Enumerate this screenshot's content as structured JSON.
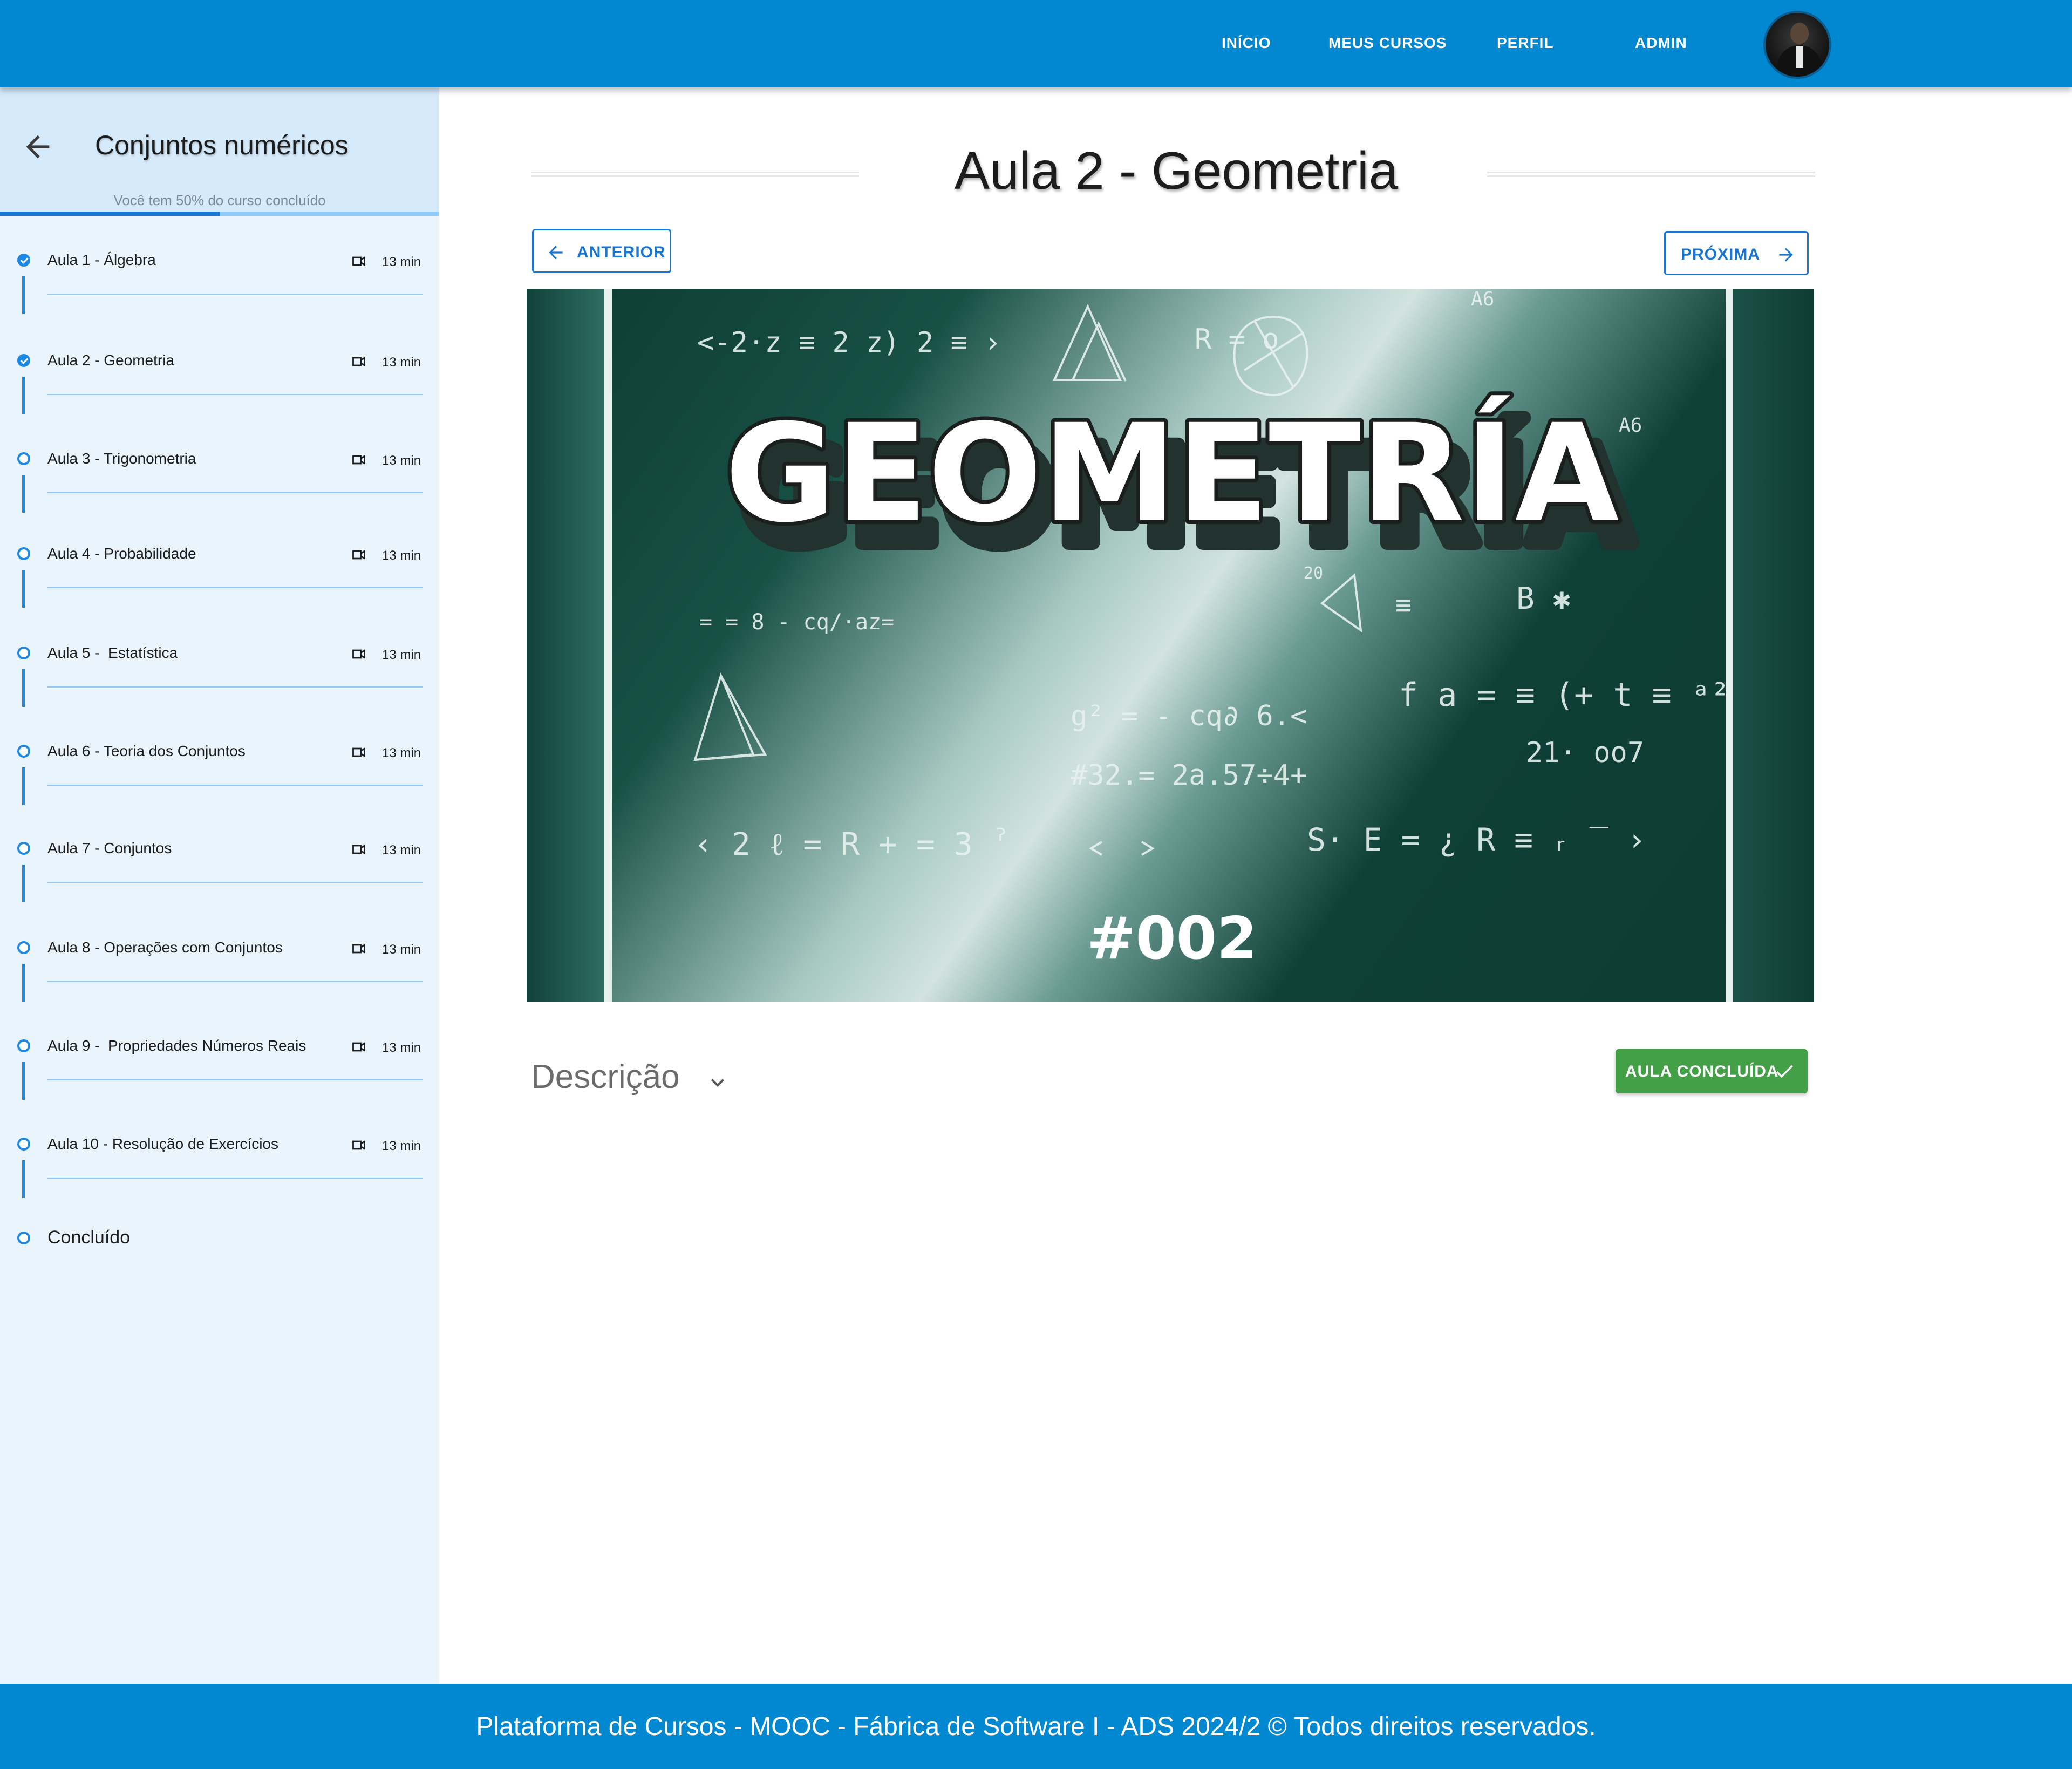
{
  "nav": {
    "items": [
      "INÍCIO",
      "MEUS CURSOS",
      "PERFIL",
      "ADMIN"
    ],
    "avatar_icon": "user-avatar"
  },
  "sidebar": {
    "course_title": "Conjuntos numéricos",
    "progress_text": "Você tem 50% do curso concluído",
    "progress_fraction": 0.5,
    "lessons": [
      {
        "label": "Aula 1 - Álgebra",
        "duration": "13 min",
        "done": true
      },
      {
        "label": "Aula 2 - Geometria",
        "duration": "13 min",
        "done": true
      },
      {
        "label": "Aula 3 - Trigonometria",
        "duration": "13 min",
        "done": false
      },
      {
        "label": "Aula 4 - Probabilidade",
        "duration": "13 min",
        "done": false
      },
      {
        "label": "Aula 5 -  Estatística",
        "duration": "13 min",
        "done": false
      },
      {
        "label": "Aula 6 - Teoria dos Conjuntos",
        "duration": "13 min",
        "done": false
      },
      {
        "label": "Aula 7 - Conjuntos",
        "duration": "13 min",
        "done": false
      },
      {
        "label": "Aula 8 - Operações com Conjuntos",
        "duration": "13 min",
        "done": false
      },
      {
        "label": "Aula 9 -  Propriedades Números Reais",
        "duration": "13 min",
        "done": false
      },
      {
        "label": "Aula 10 - Resolução de Exercícios",
        "duration": "13 min",
        "done": false
      }
    ],
    "concluded_label": "Concluído"
  },
  "main": {
    "title": "Aula 2 - Geometria",
    "prev_label": "ANTERIOR",
    "next_label": "PRÓXIMA",
    "video": {
      "headline": "GEOMETRÍA",
      "episode": "#002"
    },
    "description_label": "Descrição",
    "done_label": "AULA CONCLUÍDA"
  },
  "footer": {
    "text": "Plataforma de Cursos - MOOC - Fábrica de Software I - ADS 2024/2  ©  Todos direitos reservados."
  },
  "colors": {
    "primary": "#0288d1",
    "accent": "#1976d2",
    "success": "#43a047",
    "sidebar_bg": "#eaf4fc"
  }
}
